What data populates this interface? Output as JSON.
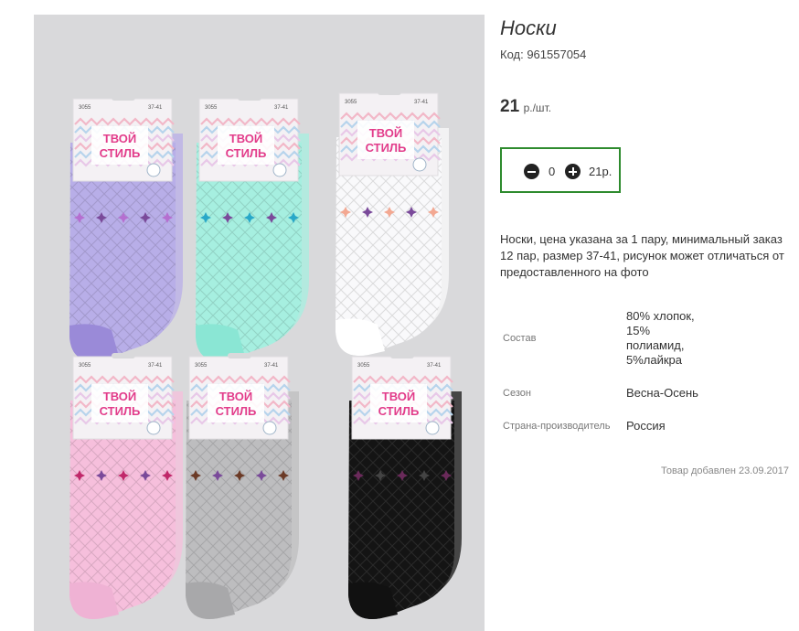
{
  "product": {
    "title": "Носки",
    "code": "Код: 961557054",
    "price_value": "21",
    "price_unit": "р./шт.",
    "quantity": "0",
    "sum": "21р.",
    "description": "Носки, цена указана за 1 пару, минимальный заказ 12 пар, размер 37-41, рисунок может отличаться от предоставленного на фото",
    "added": "Товар добавлен 23.09.2017"
  },
  "props": [
    {
      "key": "Состав",
      "value": "80% хлопок, 15% полиамид, 5%лайкра"
    },
    {
      "key": "Сезон",
      "value": "Весна-Осень"
    },
    {
      "key": "Страна-производитель",
      "value": "Россия"
    }
  ],
  "photo": {
    "card_brand_line1": "ТВОЙ",
    "card_brand_line2": "СТИЛЬ",
    "card_article": "3055",
    "card_size": "37-41",
    "sock_colors": [
      "#b8aee8",
      "#a6efe0",
      "#f9f9fb",
      "#f6bfdc",
      "#bdbdbf",
      "#141414"
    ],
    "toe_colors": [
      "#9a8ad8",
      "#8ae6d4",
      "#ffffff",
      "#efb2d4",
      "#a8a8aa",
      "#111111"
    ],
    "accent_colors": [
      "#b56fd0",
      "#28a8c8",
      "#f3a892",
      "#c0286a",
      "#6b3a26",
      "#6a2a5a"
    ]
  }
}
